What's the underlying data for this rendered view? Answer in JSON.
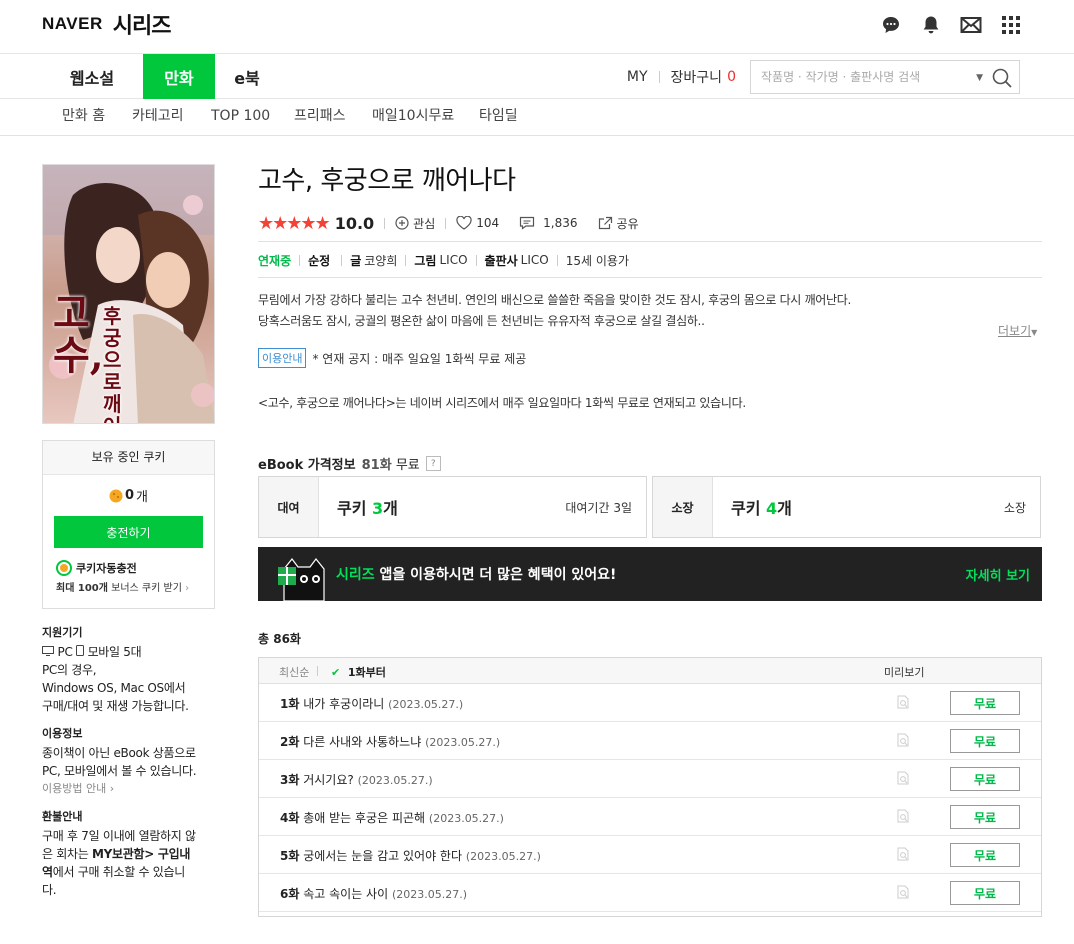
{
  "header": {
    "brand_naver": "NAVER",
    "brand_series": "시리즈"
  },
  "nav": {
    "tabs": [
      "웹소설",
      "만화",
      "e북"
    ],
    "active_tab": "만화",
    "my": "MY",
    "cart_label": "장바구니",
    "cart_count": "0",
    "search_placeholder": "작품명 · 작가명 · 출판사명 검색"
  },
  "subnav": [
    "만화 홈",
    "카테고리",
    "TOP 100",
    "프리패스",
    "매일10시무료",
    "타임딜"
  ],
  "cover": {
    "title_main": "고수,",
    "title_sub": "후궁으로 깨어나다"
  },
  "cookie": {
    "header": "보유 중인 쿠키",
    "count": "0",
    "count_unit": "개",
    "charge_label": "충전하기",
    "auto_title": "쿠키자동충전",
    "auto_sub_bold": "최대 100개",
    "auto_sub_rest": " 보너스 쿠키 받기"
  },
  "info": {
    "device_title": "지원기기",
    "device_pc": "PC",
    "device_mobile": "모바일 5대",
    "device_lines": [
      "PC의 경우,",
      "Windows OS, Mac OS에서",
      "구매/대여 및 재생 가능합니다."
    ],
    "use_title": "이용정보",
    "use_lines": [
      "종이책이 아닌 eBook 상품으로",
      "PC, 모바일에서 볼 수 있습니다."
    ],
    "use_guide": "이용방법 안내",
    "refund_title": "환불안내",
    "refund_a": "구매 후 7일 이내에 열람하지 않",
    "refund_b": "은 회차는 ",
    "refund_bold": "MY보관함> 구입내",
    "refund_bold2": "역",
    "refund_c": "에서 구매 취소할 수 있습니",
    "refund_d": "다."
  },
  "product": {
    "title": "고수, 후궁으로 깨어나다",
    "rating": 5,
    "score": "10.0",
    "interest_label": "관심",
    "likes": "104",
    "comments": "1,836",
    "share_label": "공유",
    "status": "연재중",
    "genre": "순정",
    "writer_label": "글",
    "writer": "코양희",
    "artist_label": "그림",
    "artist": "LICO",
    "publisher_label": "출판사",
    "publisher": "LICO",
    "age": "15세 이용가",
    "synopsis_1": "무림에서 가장 강하다 불리는 고수 천년비. 연인의 배신으로 쓸쓸한 죽음을 맞이한 것도 잠시, 후궁의 몸으로 다시 깨어난다.",
    "synopsis_2": "당혹스러움도 잠시, 궁궐의 평온한 삶이 마음에 든 천년비는 유유자적 후궁으로 살길 결심하..",
    "more_label": "더보기",
    "notice_tag": "이용안내",
    "notice_text": "* 연재 공지 : 매주 일요일 1화씩 무료 제공",
    "desc2": "<고수, 후궁으로 깨어나다>는 네이버 시리즈에서 매주 일요일마다 1화씩 무료로 연재되고 있습니다."
  },
  "price": {
    "title": "eBook 가격정보",
    "free_count": "81화",
    "free_label": "무료",
    "help": "?",
    "rent_label": "대여",
    "rent_prefix": "쿠키 ",
    "rent_count": "3",
    "rent_suffix": "개",
    "rent_note": "대여기간 3일",
    "own_label": "소장",
    "own_prefix": "쿠키 ",
    "own_count": "4",
    "own_suffix": "개",
    "own_note": "소장"
  },
  "banner": {
    "brand": "시리즈",
    "text": " 앱을 이용하시면 더 많은 혜택이 있어요!",
    "detail": "자세히 보기"
  },
  "episodes": {
    "total": "총 86화",
    "sort_latest": "최신순",
    "sort_first": "1화부터",
    "preview_label": "미리보기",
    "free_label": "무료",
    "items": [
      {
        "no": "1화",
        "title": "내가 후궁이라니",
        "date": "(2023.05.27.)"
      },
      {
        "no": "2화",
        "title": "다른 사내와 사통하느냐",
        "date": "(2023.05.27.)"
      },
      {
        "no": "3화",
        "title": "거시기요?",
        "date": "(2023.05.27.)"
      },
      {
        "no": "4화",
        "title": "총애 받는 후궁은 피곤해",
        "date": "(2023.05.27.)"
      },
      {
        "no": "5화",
        "title": "궁에서는 눈을 감고 있어야 한다",
        "date": "(2023.05.27.)"
      },
      {
        "no": "6화",
        "title": "속고 속이는 사이",
        "date": "(2023.05.27.)"
      }
    ]
  },
  "colors": {
    "accent": "#00c73c",
    "star": "#f44336",
    "cart_count": "#f02d2d",
    "banner_bg": "#222222"
  }
}
